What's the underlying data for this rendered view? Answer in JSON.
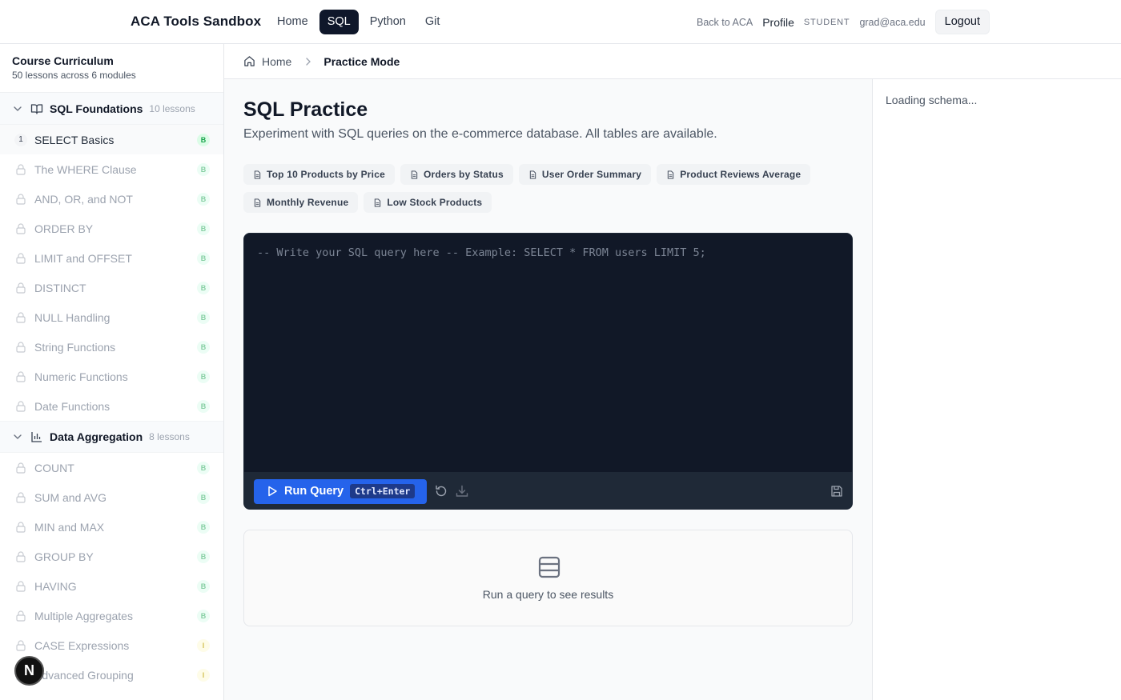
{
  "header": {
    "brand": "ACA Tools Sandbox",
    "nav": [
      {
        "label": "Home",
        "active": false
      },
      {
        "label": "SQL",
        "active": true
      },
      {
        "label": "Python",
        "active": false
      },
      {
        "label": "Git",
        "active": false
      }
    ],
    "back_link": "Back to ACA",
    "profile": "Profile",
    "role": "STUDENT",
    "email": "grad@aca.edu",
    "logout": "Logout"
  },
  "sidebar": {
    "title": "Course Curriculum",
    "subtitle": "50 lessons across 6 modules",
    "modules": [
      {
        "name": "SQL Foundations",
        "count": "10 lessons",
        "icon": "book-open-icon",
        "lessons": [
          {
            "label": "SELECT Basics",
            "number": "1",
            "badge": "B",
            "locked": false
          },
          {
            "label": "The WHERE Clause",
            "badge": "B",
            "locked": true
          },
          {
            "label": "AND, OR, and NOT",
            "badge": "B",
            "locked": true
          },
          {
            "label": "ORDER BY",
            "badge": "B",
            "locked": true
          },
          {
            "label": "LIMIT and OFFSET",
            "badge": "B",
            "locked": true
          },
          {
            "label": "DISTINCT",
            "badge": "B",
            "locked": true
          },
          {
            "label": "NULL Handling",
            "badge": "B",
            "locked": true
          },
          {
            "label": "String Functions",
            "badge": "B",
            "locked": true
          },
          {
            "label": "Numeric Functions",
            "badge": "B",
            "locked": true
          },
          {
            "label": "Date Functions",
            "badge": "B",
            "locked": true
          }
        ]
      },
      {
        "name": "Data Aggregation",
        "count": "8 lessons",
        "icon": "bar-chart-icon",
        "lessons": [
          {
            "label": "COUNT",
            "badge": "B",
            "locked": true
          },
          {
            "label": "SUM and AVG",
            "badge": "B",
            "locked": true
          },
          {
            "label": "MIN and MAX",
            "badge": "B",
            "locked": true
          },
          {
            "label": "GROUP BY",
            "badge": "B",
            "locked": true
          },
          {
            "label": "HAVING",
            "badge": "B",
            "locked": true
          },
          {
            "label": "Multiple Aggregates",
            "badge": "B",
            "locked": true
          },
          {
            "label": "CASE Expressions",
            "badge": "I",
            "locked": true
          },
          {
            "label": "Advanced Grouping",
            "badge": "I",
            "locked": true
          }
        ]
      }
    ],
    "fab_label": "N"
  },
  "breadcrumb": {
    "home": "Home",
    "current": "Practice Mode"
  },
  "main": {
    "title": "SQL Practice",
    "description": "Experiment with SQL queries on the e-commerce database. All tables are available.",
    "examples": [
      "Top 10 Products by Price",
      "Orders by Status",
      "User Order Summary",
      "Product Reviews Average",
      "Monthly Revenue",
      "Low Stock Products"
    ],
    "editor": {
      "value": "",
      "placeholder": "-- Write your SQL query here -- Example: SELECT * FROM users LIMIT 5;"
    },
    "run_label": "Run Query",
    "run_shortcut": "Ctrl+Enter",
    "results_empty": "Run a query to see results"
  },
  "schema": {
    "status": "Loading schema..."
  },
  "colors": {
    "primary": "#2563eb",
    "editor_bg": "#111827",
    "toolbar_bg": "#1f2937",
    "active_nav": "#0f172a"
  }
}
